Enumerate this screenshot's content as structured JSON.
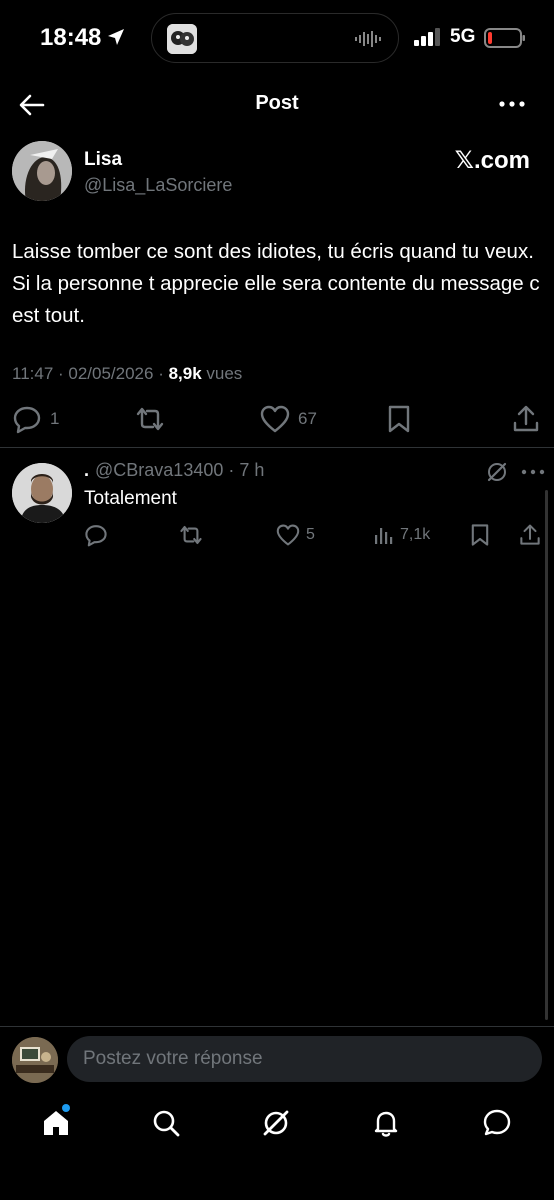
{
  "status_bar": {
    "time": "18:48",
    "network": "5G"
  },
  "header": {
    "title": "Post"
  },
  "post": {
    "author_name": "Lisa",
    "author_handle": "@Lisa_LaSorciere",
    "brand": "𝕏.com",
    "text": "Laisse tomber ce sont des idiotes, tu écris quand tu veux. Si la personne t apprecie elle sera contente du message c est tout.",
    "timestamp": "11:47 · 02/05/2026 · ",
    "views_count": "8,9k",
    "views_label": " vues",
    "replies": "1",
    "likes": "67"
  },
  "reply": {
    "name": ".",
    "handle_time": "@CBrava13400 · 7 h",
    "text": "Totalement",
    "likes": "5",
    "views": "7,1k"
  },
  "composer": {
    "placeholder": "Postez votre réponse"
  },
  "colors": {
    "background": "#000000",
    "muted": "#71767b",
    "accent": "#1d9bf0"
  },
  "nav": [
    "home-icon",
    "search-icon",
    "grok-icon",
    "notifications-icon",
    "messages-icon"
  ]
}
